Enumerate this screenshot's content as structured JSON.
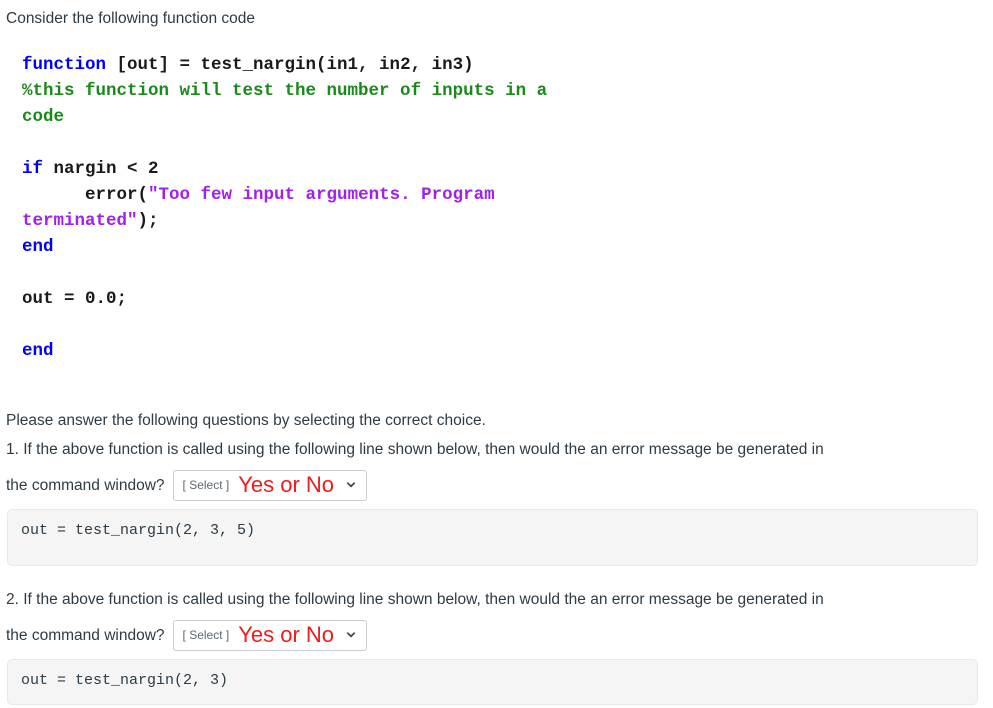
{
  "intro": {
    "text": "Consider the following function code"
  },
  "code_listing": {
    "language": "matlab",
    "lines": [
      [
        {
          "t": "function",
          "c": "kw"
        },
        {
          "t": " [out] = test_nargin(in1, in2, in3)",
          "c": "pln"
        }
      ],
      [
        {
          "t": "%this function will test the number of inputs in a",
          "c": "cmt"
        }
      ],
      [
        {
          "t": "code",
          "c": "cmt"
        }
      ],
      [],
      [
        {
          "t": "if",
          "c": "kw"
        },
        {
          "t": " nargin < 2",
          "c": "pln"
        }
      ],
      [
        {
          "t": "      error(",
          "c": "pln"
        },
        {
          "t": "\"Too few input arguments. Program",
          "c": "str"
        }
      ],
      [
        {
          "t": "terminated\"",
          "c": "str"
        },
        {
          "t": ");",
          "c": "pln"
        }
      ],
      [
        {
          "t": "end",
          "c": "kw"
        }
      ],
      [],
      [
        {
          "t": "out = 0.0;",
          "c": "pln"
        }
      ],
      [],
      [
        {
          "t": "end",
          "c": "kw"
        }
      ]
    ],
    "colors": {
      "keyword": "#0000ff",
      "comment": "#1a8a1a",
      "string": "#a020f0",
      "plain": "#1a1a1a"
    }
  },
  "instructions": {
    "text": "Please answer the following questions by selecting the correct choice."
  },
  "questions": [
    {
      "line1": "1. If the above function is called using the following line shown below, then would the an error message be generated in",
      "line2": "the command window?",
      "select": {
        "placeholder": "[ Select ]",
        "value": "Yes or No",
        "value_color": "#ee1c1c",
        "chevron_icon": "chevron-down-icon"
      },
      "code": "out = test_nargin(2, 3, 5)"
    },
    {
      "line1": "2. If the above function is called using the following line shown below, then would the an error message be generated in",
      "line2": "the command window?",
      "select": {
        "placeholder": "[ Select ]",
        "value": "Yes or No",
        "value_color": "#ee1c1c",
        "chevron_icon": "chevron-down-icon"
      },
      "code": "out = test_nargin(2, 3)"
    }
  ]
}
